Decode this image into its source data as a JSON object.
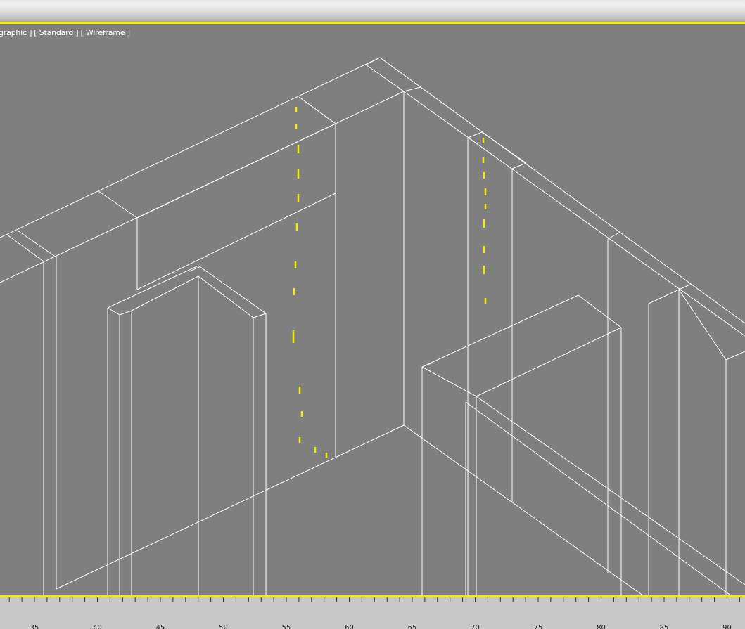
{
  "viewport": {
    "label_parts": [
      "graphic ]",
      "[ Standard ]",
      "[ Wireframe ]"
    ],
    "wire_color": "#ffffff",
    "selection_color": "#f0f000",
    "background_color": "#7f7f7f"
  },
  "timeline": {
    "tick_labels": [
      "35",
      "40",
      "45",
      "50",
      "55",
      "60",
      "65",
      "70",
      "75",
      "80",
      "85",
      "90"
    ]
  }
}
